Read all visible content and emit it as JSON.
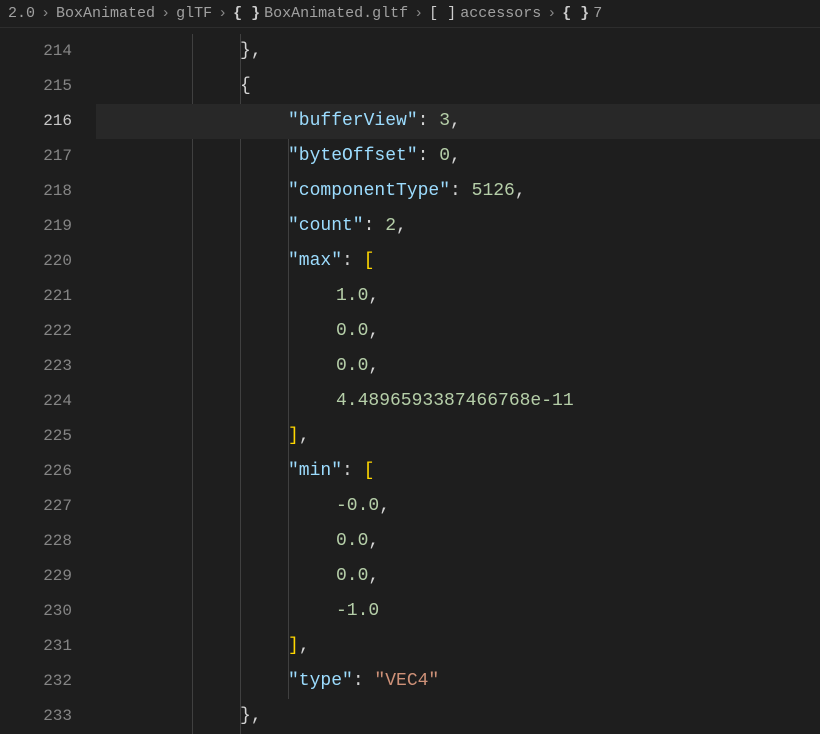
{
  "breadcrumb": {
    "items": [
      {
        "label": "2.0",
        "icon": null
      },
      {
        "label": "BoxAnimated",
        "icon": null
      },
      {
        "label": "glTF",
        "icon": null
      },
      {
        "label": "BoxAnimated.gltf",
        "icon": "braces"
      },
      {
        "label": "accessors",
        "icon": "brackets"
      },
      {
        "label": "7",
        "icon": "braces"
      }
    ]
  },
  "editor": {
    "activeLine": 216,
    "lines": [
      {
        "num": 214,
        "indent": 3,
        "tokens": [
          {
            "t": "brace",
            "v": "}"
          },
          {
            "t": "comma",
            "v": ","
          }
        ]
      },
      {
        "num": 215,
        "indent": 3,
        "tokens": [
          {
            "t": "brace",
            "v": "{"
          }
        ]
      },
      {
        "num": 216,
        "indent": 4,
        "tokens": [
          {
            "t": "key",
            "v": "\"bufferView\""
          },
          {
            "t": "colon",
            "v": ": "
          },
          {
            "t": "number",
            "v": "3"
          },
          {
            "t": "comma",
            "v": ","
          }
        ]
      },
      {
        "num": 217,
        "indent": 4,
        "tokens": [
          {
            "t": "key",
            "v": "\"byteOffset\""
          },
          {
            "t": "colon",
            "v": ": "
          },
          {
            "t": "number",
            "v": "0"
          },
          {
            "t": "comma",
            "v": ","
          }
        ]
      },
      {
        "num": 218,
        "indent": 4,
        "tokens": [
          {
            "t": "key",
            "v": "\"componentType\""
          },
          {
            "t": "colon",
            "v": ": "
          },
          {
            "t": "number",
            "v": "5126"
          },
          {
            "t": "comma",
            "v": ","
          }
        ]
      },
      {
        "num": 219,
        "indent": 4,
        "tokens": [
          {
            "t": "key",
            "v": "\"count\""
          },
          {
            "t": "colon",
            "v": ": "
          },
          {
            "t": "number",
            "v": "2"
          },
          {
            "t": "comma",
            "v": ","
          }
        ]
      },
      {
        "num": 220,
        "indent": 4,
        "tokens": [
          {
            "t": "key",
            "v": "\"max\""
          },
          {
            "t": "colon",
            "v": ": "
          },
          {
            "t": "bracket",
            "v": "["
          }
        ]
      },
      {
        "num": 221,
        "indent": 5,
        "tokens": [
          {
            "t": "number",
            "v": "1.0"
          },
          {
            "t": "comma",
            "v": ","
          }
        ]
      },
      {
        "num": 222,
        "indent": 5,
        "tokens": [
          {
            "t": "number",
            "v": "0.0"
          },
          {
            "t": "comma",
            "v": ","
          }
        ]
      },
      {
        "num": 223,
        "indent": 5,
        "tokens": [
          {
            "t": "number",
            "v": "0.0"
          },
          {
            "t": "comma",
            "v": ","
          }
        ]
      },
      {
        "num": 224,
        "indent": 5,
        "tokens": [
          {
            "t": "number",
            "v": "4.4896593387466768e-11"
          }
        ]
      },
      {
        "num": 225,
        "indent": 4,
        "tokens": [
          {
            "t": "bracket",
            "v": "]"
          },
          {
            "t": "comma",
            "v": ","
          }
        ]
      },
      {
        "num": 226,
        "indent": 4,
        "tokens": [
          {
            "t": "key",
            "v": "\"min\""
          },
          {
            "t": "colon",
            "v": ": "
          },
          {
            "t": "bracket",
            "v": "["
          }
        ]
      },
      {
        "num": 227,
        "indent": 5,
        "tokens": [
          {
            "t": "number",
            "v": "-0.0"
          },
          {
            "t": "comma",
            "v": ","
          }
        ]
      },
      {
        "num": 228,
        "indent": 5,
        "tokens": [
          {
            "t": "number",
            "v": "0.0"
          },
          {
            "t": "comma",
            "v": ","
          }
        ]
      },
      {
        "num": 229,
        "indent": 5,
        "tokens": [
          {
            "t": "number",
            "v": "0.0"
          },
          {
            "t": "comma",
            "v": ","
          }
        ]
      },
      {
        "num": 230,
        "indent": 5,
        "tokens": [
          {
            "t": "number",
            "v": "-1.0"
          }
        ]
      },
      {
        "num": 231,
        "indent": 4,
        "tokens": [
          {
            "t": "bracket",
            "v": "]"
          },
          {
            "t": "comma",
            "v": ","
          }
        ]
      },
      {
        "num": 232,
        "indent": 4,
        "tokens": [
          {
            "t": "key",
            "v": "\"type\""
          },
          {
            "t": "colon",
            "v": ": "
          },
          {
            "t": "string",
            "v": "\"VEC4\""
          }
        ]
      },
      {
        "num": 233,
        "indent": 3,
        "tokens": [
          {
            "t": "brace",
            "v": "}"
          },
          {
            "t": "comma",
            "v": ","
          }
        ]
      }
    ]
  },
  "indentSize": 48
}
